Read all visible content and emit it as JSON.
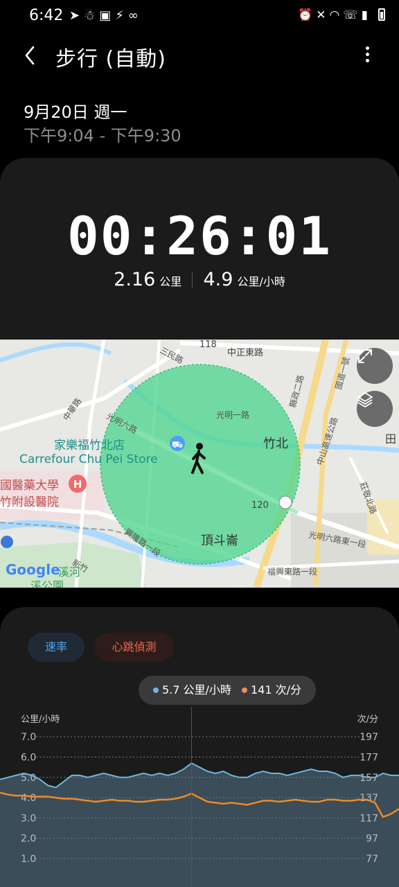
{
  "status_bar": {
    "time": "6:42",
    "left_icons": [
      "telegram-icon",
      "notification-icon",
      "media-icon",
      "bolt-icon",
      "link-icon"
    ],
    "right_icons": [
      "alarm-icon",
      "mute-icon",
      "wifi-icon",
      "wifi-call-icon",
      "signal-icon",
      "battery-icon"
    ]
  },
  "header": {
    "title": "步行 (自動)"
  },
  "session": {
    "date": "9月20日 週一",
    "time_range": "下午9:04 - 下午9:30"
  },
  "summary": {
    "duration": "00:26:01",
    "distance_value": "2.16",
    "distance_unit": "公里",
    "speed_value": "4.9",
    "speed_unit": "公里/小時"
  },
  "map": {
    "labels": {
      "store_zh": "家樂福竹北店",
      "store_en": "Carrefour Chu Pei Store",
      "hospital_line1": "國醫藥大學",
      "hospital_line2": "竹附設醫院",
      "zhubei": "竹北",
      "dingdou": "頂斗崙",
      "road_118": "118",
      "road_zhongzheng": "中正東路",
      "road_sanmin": "三民路",
      "road_zhonghua": "中華路",
      "road_guangming6": "光明六路",
      "road_guangming1": "光明一路",
      "road_120": "120",
      "road_guangming6e": "光明六路東一段",
      "road_xinglong": "興隆路一段",
      "road_fuxing": "福興東路一段",
      "road_zhongshan": "中山高速公路",
      "road_guodao": "國道一號",
      "road_xianzheng": "縣政二路",
      "road_zhuangjing": "莊敬北路",
      "park": "溪河",
      "park2": "溪公園",
      "xinzhu": "新竹",
      "tian": "田",
      "google": "Google"
    },
    "buttons": [
      "expand-icon",
      "layers-icon"
    ]
  },
  "chart_section": {
    "tabs": [
      {
        "label": "速率",
        "color": "#4ea3e8"
      },
      {
        "label": "心跳偵測",
        "color": "#ea6a4e"
      }
    ],
    "tooltip": {
      "speed_value": "5.7",
      "speed_unit": "公里/小時",
      "hr_value": "141",
      "hr_unit": "次/分"
    }
  },
  "chart_data": {
    "type": "area",
    "left_axis_label": "公里/小時",
    "right_axis_label": "次/分",
    "left_ticks": [
      "7.0",
      "6.0",
      "5.0",
      "4.0",
      "3.0",
      "2.0",
      "1.0"
    ],
    "right_ticks": [
      "197",
      "177",
      "157",
      "137",
      "117",
      "97",
      "77"
    ],
    "ylim_left": [
      0,
      7.5
    ],
    "ylim_right": [
      57,
      207
    ],
    "series": [
      {
        "name": "速率",
        "unit": "公里/小時",
        "color": "#6fb7e0",
        "values": [
          4.9,
          5.0,
          5.1,
          5.2,
          5.1,
          4.9,
          4.6,
          4.5,
          4.8,
          5.1,
          5.1,
          5.0,
          5.1,
          5.2,
          5.1,
          5.0,
          5.0,
          5.1,
          5.2,
          5.1,
          5.2,
          5.1,
          5.2,
          5.4,
          5.7,
          5.5,
          5.3,
          5.2,
          5.3,
          5.1,
          5.0,
          5.0,
          5.2,
          5.3,
          5.2,
          5.2,
          5.1,
          5.2,
          5.3,
          5.4,
          5.3,
          5.3,
          5.2,
          5.0,
          5.1,
          5.1,
          5.0,
          5.0,
          5.2,
          5.1,
          5.1
        ]
      },
      {
        "name": "心跳偵測",
        "unit": "次/分",
        "color": "#f08a24",
        "values": [
          142,
          140,
          139,
          139,
          138,
          138,
          138,
          137,
          136,
          136,
          135,
          134,
          133,
          134,
          135,
          134,
          134,
          133,
          133,
          134,
          135,
          135,
          136,
          138,
          141,
          137,
          133,
          132,
          131,
          132,
          131,
          130,
          132,
          134,
          134,
          133,
          134,
          135,
          134,
          133,
          133,
          135,
          135,
          134,
          134,
          135,
          135,
          132,
          118,
          121,
          126
        ]
      }
    ],
    "selected_index": 24
  }
}
